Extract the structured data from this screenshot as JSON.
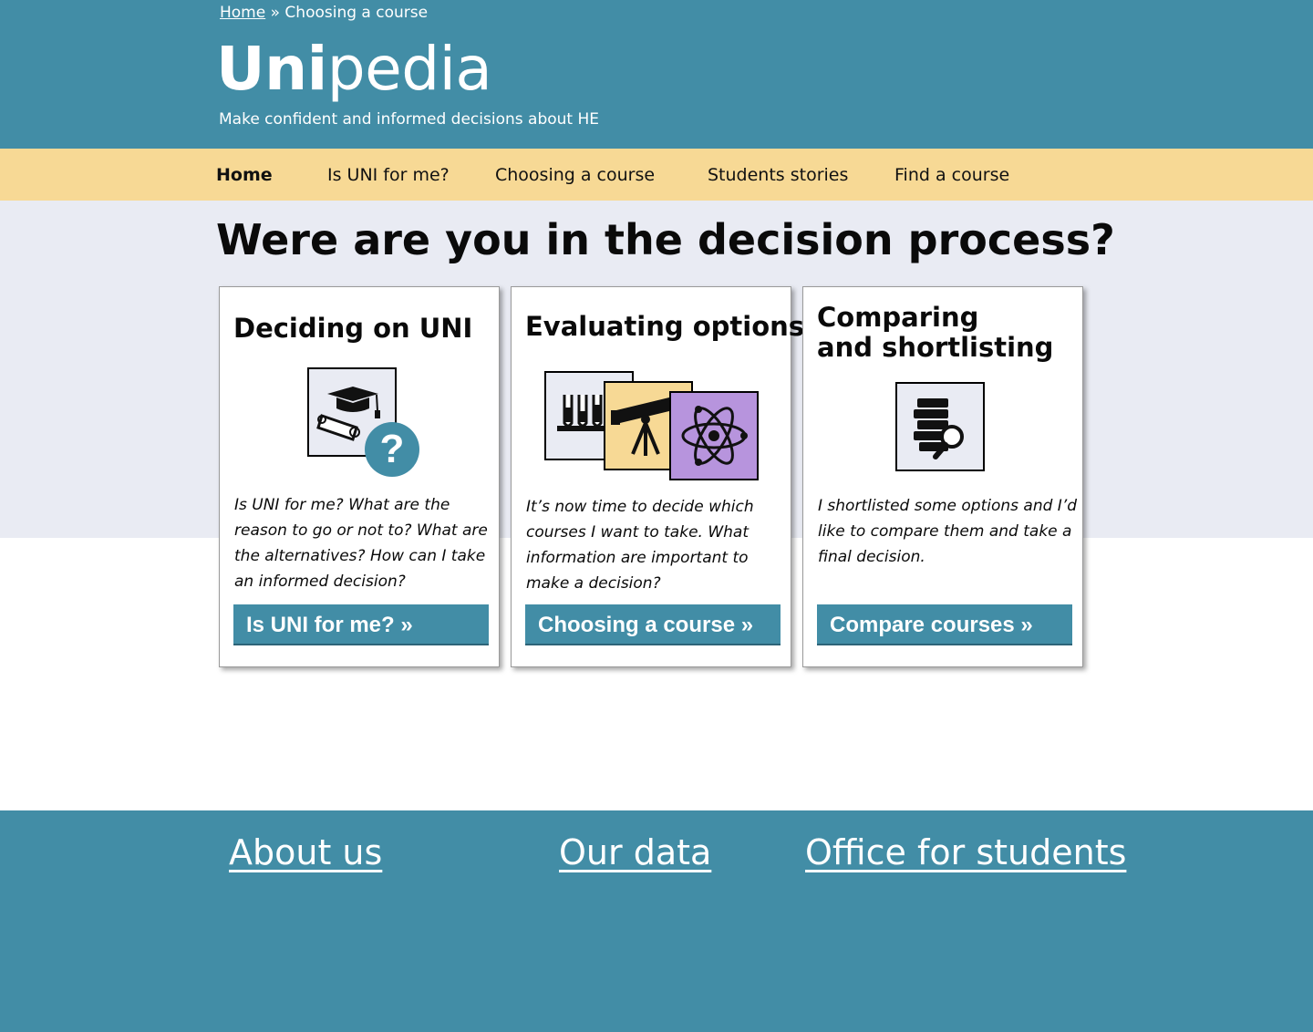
{
  "breadcrumb": {
    "home": "Home",
    "separator": "»",
    "current": "Choosing a course"
  },
  "logo": {
    "bold": "Uni",
    "light": "pedia"
  },
  "tagline": "Make confident and informed decisions about HE",
  "nav": {
    "items": [
      {
        "label": "Home",
        "active": true
      },
      {
        "label": "Is UNI for me?",
        "active": false
      },
      {
        "label": "Choosing a course",
        "active": false
      },
      {
        "label": "Students stories",
        "active": false
      },
      {
        "label": "Find a course",
        "active": false
      }
    ]
  },
  "headline": "Were are you in the decision process?",
  "cards": [
    {
      "title": "Deciding on UNI",
      "icon": "graduation-cap-question-icon",
      "description": "Is UNI for me? What are the reason to go or not to? What are the alternatives? How can I take an informed decision?",
      "button": "Is UNI for me?  »"
    },
    {
      "title": "Evaluating options",
      "icon": "subjects-icon",
      "description": "It’s now time to decide which courses I want to take. What information are important to make a decision?",
      "button": "Choosing a course »"
    },
    {
      "title_line1": "Comparing",
      "title_line2": "and shortlisting",
      "icon": "books-magnifier-icon",
      "description": "I shortlisted some options and I’d like to compare them and take a final decision.",
      "button": "Compare courses »"
    }
  ],
  "footer": {
    "links": [
      "About us",
      "Our data",
      "Office for students"
    ]
  },
  "colors": {
    "brand": "#428da6",
    "nav_bg": "#f7d995",
    "hero_bg": "#e9ebf3",
    "icon_light": "#e9ebf3",
    "icon_yellow": "#f7d995",
    "icon_purple": "#b794dd"
  }
}
